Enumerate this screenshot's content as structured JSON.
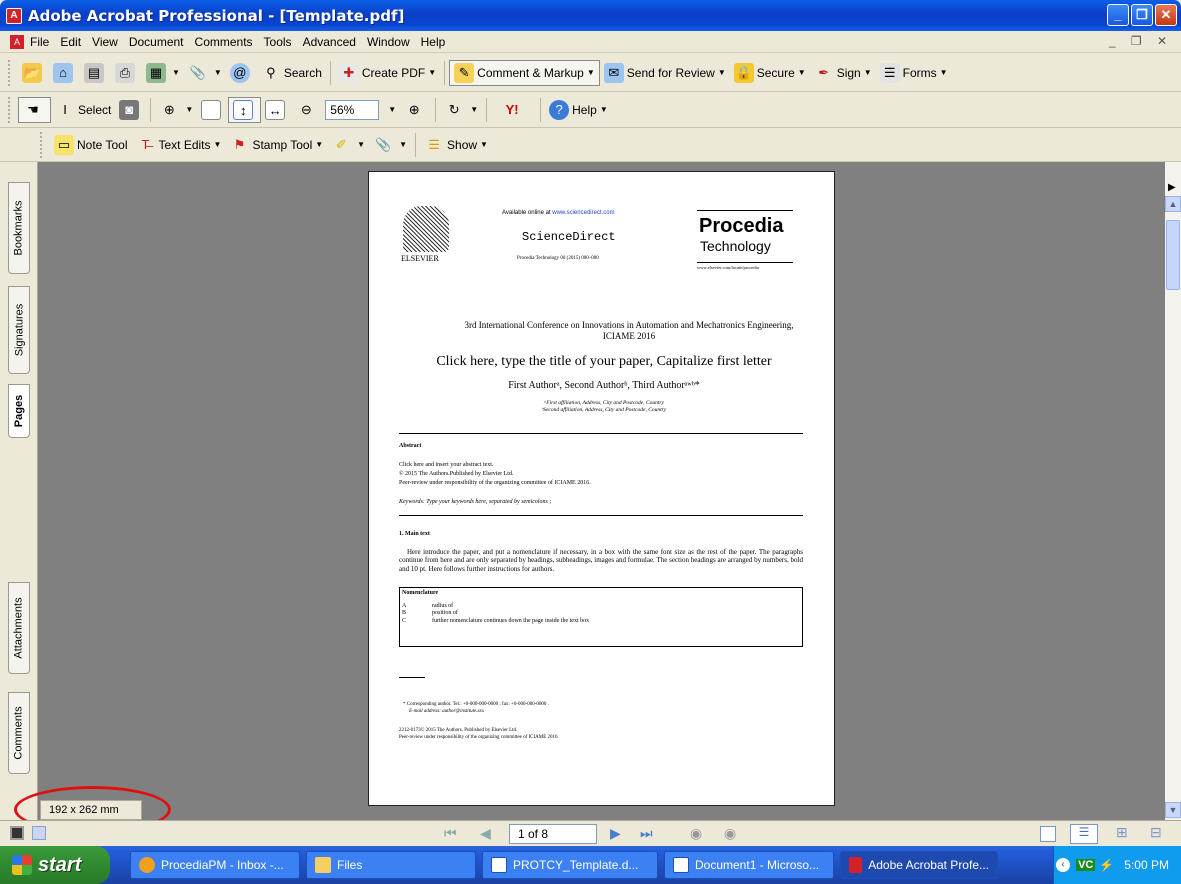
{
  "window": {
    "title": "Adobe Acrobat Professional - [Template.pdf]"
  },
  "menu": [
    "File",
    "Edit",
    "View",
    "Document",
    "Comments",
    "Tools",
    "Advanced",
    "Window",
    "Help"
  ],
  "toolbar1": {
    "search": "Search",
    "create_pdf": "Create PDF",
    "comment_markup": "Comment & Markup",
    "send_review": "Send for Review",
    "secure": "Secure",
    "sign": "Sign",
    "forms": "Forms"
  },
  "toolbar2": {
    "select": "Select",
    "zoom": "56%",
    "help": "Help"
  },
  "toolbar3": {
    "note_tool": "Note Tool",
    "text_edits": "Text Edits",
    "stamp_tool": "Stamp Tool",
    "show": "Show"
  },
  "side_tabs": [
    "Bookmarks",
    "Signatures",
    "Pages",
    "Attachments",
    "Comments"
  ],
  "page_size": "192 x 262 mm",
  "page_nav": {
    "page": "1 of 8"
  },
  "pdf": {
    "available": "Available online at ",
    "link": "www.sciencedirect.com",
    "sciencedirect": "ScienceDirect",
    "journal_ref": "Procedia Technology 00 (2015) 000–000",
    "elsevier": "ELSEVIER",
    "procedia": "Procedia",
    "technology": "Technology",
    "url": "www.elsevier.com/locate/procedia",
    "conference": "3rd International Conference on Innovations in Automation and Mechatronics Engineering, ICIAME 2016",
    "title": "Click here, type the title of your paper, Capitalize first letter",
    "authors": "First Authorᵃ, Second Authorᵇ, Third Authorᵃʷᵇ*",
    "aff1": "ᵃFirst affiliation, Address, City and Postcode, Country",
    "aff2": "ᵇSecond affiliation, Address, City and Postcode, Country",
    "abstract_head": "Abstract",
    "abstract": "Click here and insert your abstract text.",
    "copyright": "© 2015 The Authors.Published by Elsevier Ltd.",
    "peer": "Peer-review under responsibility of the organizing committee of ICIAME 2016.",
    "keywords": "Keywords: Type your keywords here, separated by semicolons ;",
    "main_head": "1. Main text",
    "main_text": "Here introduce the paper, and put a nomenclature if necessary, in a box with the same font size as the rest of the paper. The paragraphs continue from here and are only separated by headings, subheadings, images and formulae. The section headings are arranged by numbers, bold and 10 pt. Here follows further instructions for authors.",
    "nomenclature": "Nomenclature",
    "nom": [
      [
        "A",
        "radius of"
      ],
      [
        "B",
        "position of"
      ],
      [
        "C",
        "further nomenclature continues down the page inside the text box"
      ]
    ],
    "corresponding": "* Corresponding author. Tel.: +0-000-000-0000 ; fax: +0-000-000-0000 .",
    "email": "E-mail address: author@institute.xxx",
    "issn": "2212-0173© 2015 The Authors. Published by Elsevier Ltd.",
    "peer2": "Peer-review under responsibility of the organizing committee of ICIAME 2016."
  },
  "taskbar": {
    "start": "start",
    "tasks": [
      "ProcediaPM - Inbox -...",
      "Files",
      "PROTCY_Template.d...",
      "Document1 - Microso...",
      "Adobe Acrobat Profe..."
    ],
    "time": "5:00 PM"
  }
}
